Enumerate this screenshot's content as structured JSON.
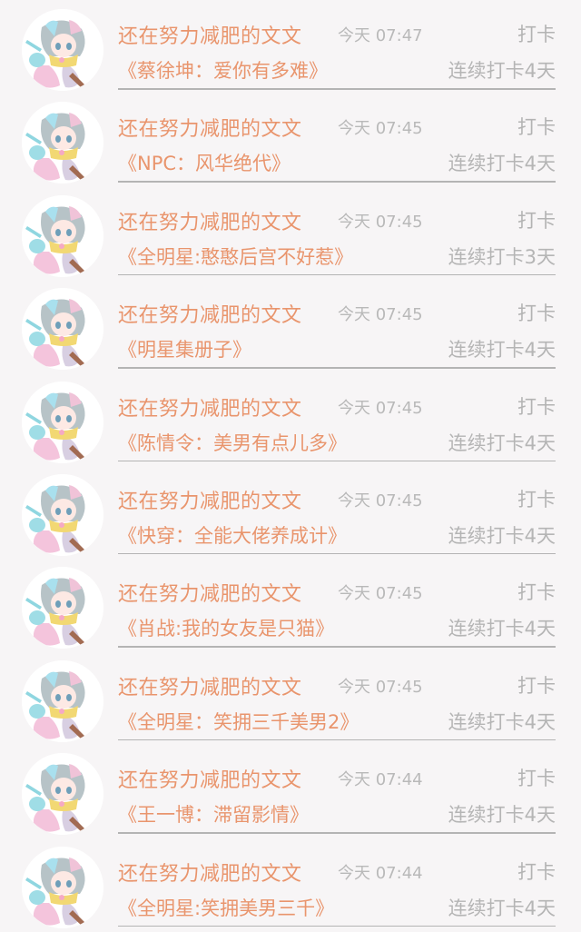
{
  "rows": [
    {
      "name": "还在努力减肥的文文",
      "time": "今天 07:47",
      "action": "打卡",
      "title": "《蔡徐坤：爱你有多难》",
      "streak": "连续打卡4天"
    },
    {
      "name": "还在努力减肥的文文",
      "time": "今天 07:45",
      "action": "打卡",
      "title": "《NPC：风华绝代》",
      "streak": "连续打卡4天"
    },
    {
      "name": "还在努力减肥的文文",
      "time": "今天 07:45",
      "action": "打卡",
      "title": "《全明星:憨憨后宫不好惹》",
      "streak": "连续打卡3天"
    },
    {
      "name": "还在努力减肥的文文",
      "time": "今天 07:45",
      "action": "打卡",
      "title": "《明星集册子》",
      "streak": "连续打卡4天"
    },
    {
      "name": "还在努力减肥的文文",
      "time": "今天 07:45",
      "action": "打卡",
      "title": "《陈情令：美男有点儿多》",
      "streak": "连续打卡4天"
    },
    {
      "name": "还在努力减肥的文文",
      "time": "今天 07:45",
      "action": "打卡",
      "title": "《快穿：全能大佬养成计》",
      "streak": "连续打卡4天"
    },
    {
      "name": "还在努力减肥的文文",
      "time": "今天 07:45",
      "action": "打卡",
      "title": "《肖战:我的女友是只猫》",
      "streak": "连续打卡4天"
    },
    {
      "name": "还在努力减肥的文文",
      "time": "今天 07:45",
      "action": "打卡",
      "title": "《全明星：笑拥三千美男2》",
      "streak": "连续打卡4天"
    },
    {
      "name": "还在努力减肥的文文",
      "time": "今天 07:44",
      "action": "打卡",
      "title": "《王一博：滞留影情》",
      "streak": "连续打卡4天"
    },
    {
      "name": "还在努力减肥的文文",
      "time": "今天 07:44",
      "action": "打卡",
      "title": "《全明星:笑拥美男三千》",
      "streak": "连续打卡4天"
    }
  ],
  "colors": {
    "name": "#e9956d",
    "meta": "#b5b5b5",
    "background": "#f7f5f6"
  }
}
